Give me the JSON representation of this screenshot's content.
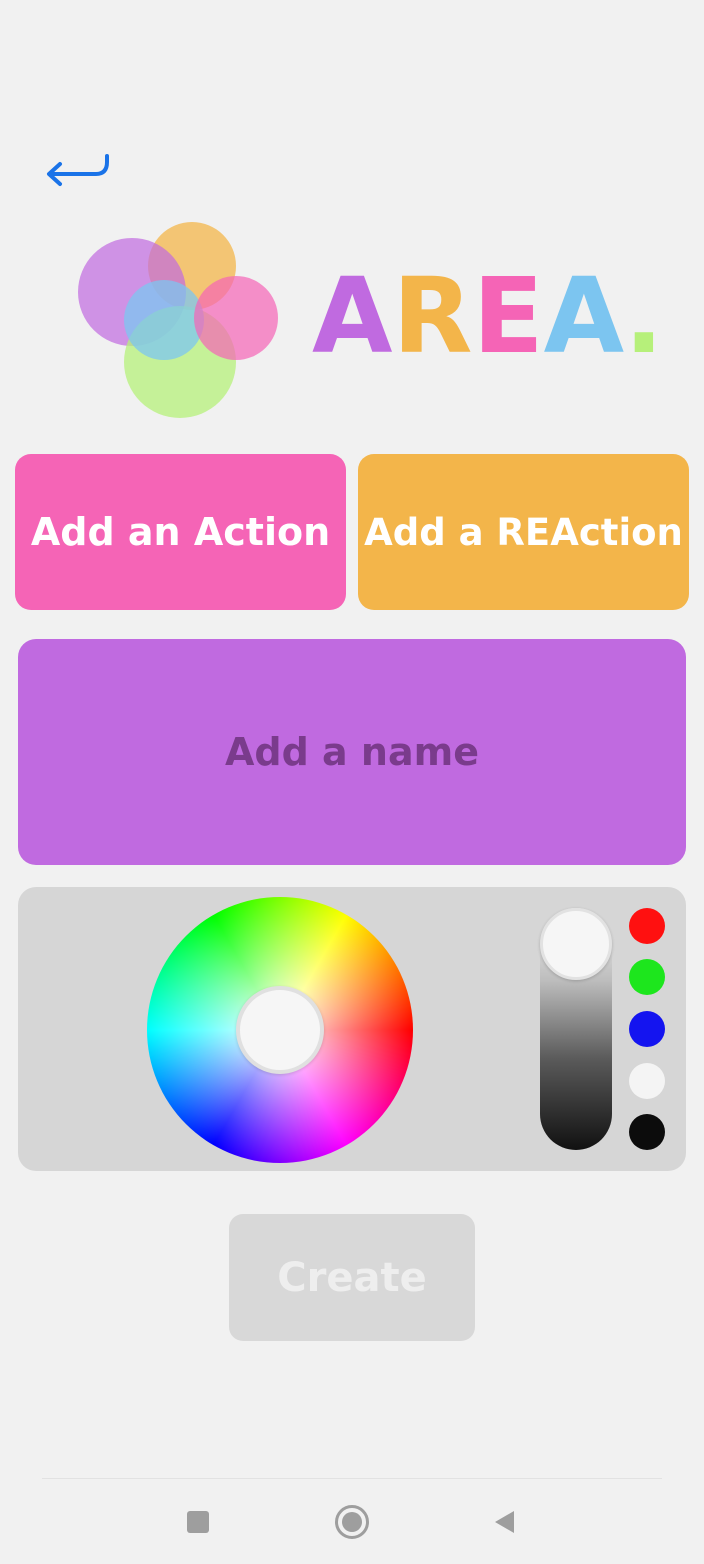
{
  "header": {
    "back_icon": "return-arrow-icon"
  },
  "logo": {
    "mark_icon": "overlapping-circles-logo",
    "wordmark": {
      "letters": [
        {
          "char": "A",
          "color": "#c06ae0"
        },
        {
          "char": "R",
          "color": "#f3b54a"
        },
        {
          "char": "E",
          "color": "#f564b6"
        },
        {
          "char": "A",
          "color": "#7cc5f0"
        },
        {
          "char": ".",
          "color": "#b6f07a"
        }
      ]
    }
  },
  "buttons": {
    "add_action_label": "Add an Action",
    "add_reaction_label": "Add a REAction",
    "create_label": "Create"
  },
  "name_field": {
    "placeholder": "Add a name",
    "value": ""
  },
  "color_picker": {
    "wheel_icon": "color-wheel",
    "brightness_level": 1.0,
    "swatches": [
      {
        "name": "red",
        "color": "#ff1010"
      },
      {
        "name": "green",
        "color": "#1de61d"
      },
      {
        "name": "blue",
        "color": "#1414f0"
      },
      {
        "name": "white",
        "color": "#f4f4f4"
      },
      {
        "name": "black",
        "color": "#0c0c0c"
      }
    ]
  },
  "colors": {
    "background": "#f1f1f1",
    "action_button": "#f564b6",
    "reaction_button": "#f3b54a",
    "name_field": "#c06ae0",
    "name_text": "#7a3b8c",
    "picker_panel": "#d6d6d6",
    "create_button": "#d8d8d8",
    "back_arrow": "#1a73e8"
  },
  "navbar": {
    "recents_icon": "square-recents-icon",
    "home_icon": "circle-home-icon",
    "back_icon": "triangle-back-icon"
  }
}
